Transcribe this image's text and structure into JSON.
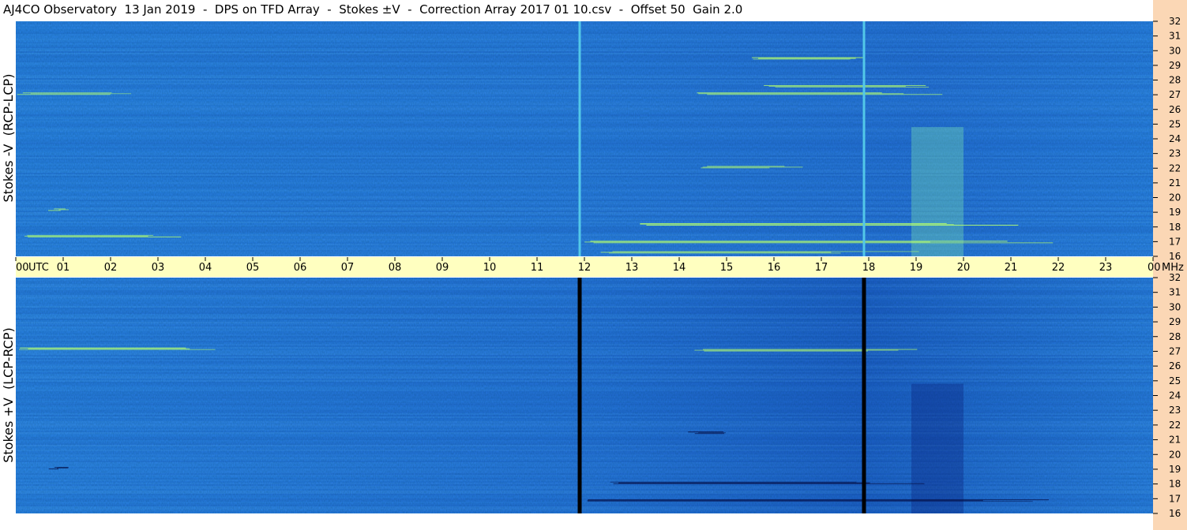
{
  "title": "AJ4CO Observatory  13 Jan 2019  -  DPS on TFD Array  -  Stokes ±V  -  Correction Array 2017 01 10.csv  -  Offset 50  Gain 2.0",
  "colors": {
    "background_blue": "#2a7fe8",
    "time_band": "#ffffc0",
    "mhz_strip": "#fbd7b5",
    "upper_marker_line": "#53c8e8",
    "lower_marker_line": "#000000"
  },
  "chart_data": [
    {
      "type": "heatmap",
      "name": "upper-panel",
      "ylabel": "Stokes -V  (RCP-LCP)",
      "x": {
        "unit": "UTC",
        "range": [
          0,
          24
        ]
      },
      "y": {
        "unit": "MHz",
        "range": [
          16,
          32
        ],
        "ticks": [
          "32",
          "31",
          "30",
          "29",
          "28",
          "27",
          "26",
          "25",
          "24",
          "23",
          "22",
          "21",
          "20",
          "19",
          "18",
          "17",
          "16"
        ]
      },
      "vertical_markers_utc": [
        11.9,
        17.9
      ],
      "features": [
        {
          "utc_start": 12.3,
          "utc_end": 19.5,
          "mhz": 16.3,
          "kind": "bright"
        },
        {
          "utc_start": 12.0,
          "utc_end": 22.5,
          "mhz": 17.0,
          "kind": "bright"
        },
        {
          "utc_start": 13.0,
          "utc_end": 21.0,
          "mhz": 18.2,
          "kind": "bright"
        },
        {
          "utc_start": 14.3,
          "utc_end": 19.3,
          "mhz": 27.1,
          "kind": "bright"
        },
        {
          "utc_start": 15.7,
          "utc_end": 19.8,
          "mhz": 27.6,
          "kind": "bright"
        },
        {
          "utc_start": 15.5,
          "utc_end": 18.6,
          "mhz": 29.5,
          "kind": "bright"
        },
        {
          "utc_start": 14.3,
          "utc_end": 16.5,
          "mhz": 22.1,
          "kind": "bright"
        },
        {
          "utc_start": 0.0,
          "utc_end": 2.5,
          "mhz": 27.1,
          "kind": "bright"
        },
        {
          "utc_start": 0.1,
          "utc_end": 3.6,
          "mhz": 17.4,
          "kind": "bright"
        },
        {
          "utc_start": 0.6,
          "utc_end": 0.9,
          "mhz": 19.2,
          "kind": "bright"
        }
      ]
    },
    {
      "type": "heatmap",
      "name": "lower-panel",
      "ylabel": "Stokes +V  (LCP-RCP)",
      "x": {
        "unit": "UTC",
        "range": [
          0,
          24
        ]
      },
      "y": {
        "unit": "MHz",
        "range": [
          16,
          32
        ],
        "ticks": [
          "32",
          "31",
          "30",
          "29",
          "28",
          "27",
          "26",
          "25",
          "24",
          "23",
          "22",
          "21",
          "20",
          "19",
          "18",
          "17",
          "16"
        ]
      },
      "vertical_markers_utc": [
        11.9,
        17.9
      ],
      "features": [
        {
          "utc_start": 12.0,
          "utc_end": 22.3,
          "mhz": 16.9,
          "kind": "dark"
        },
        {
          "utc_start": 12.5,
          "utc_end": 20.0,
          "mhz": 18.1,
          "kind": "dark"
        },
        {
          "utc_start": 14.3,
          "utc_end": 19.2,
          "mhz": 27.1,
          "kind": "bright"
        },
        {
          "utc_start": 14.1,
          "utc_end": 15.0,
          "mhz": 21.5,
          "kind": "dark"
        },
        {
          "utc_start": 0.0,
          "utc_end": 5.5,
          "mhz": 27.2,
          "kind": "bright"
        },
        {
          "utc_start": 0.6,
          "utc_end": 0.9,
          "mhz": 19.1,
          "kind": "dark"
        }
      ]
    }
  ],
  "time_axis": {
    "utc_label": "UTC",
    "mhz_label": "MHz",
    "hours": [
      "00",
      "01",
      "02",
      "03",
      "04",
      "05",
      "06",
      "07",
      "08",
      "09",
      "10",
      "11",
      "12",
      "13",
      "14",
      "15",
      "16",
      "17",
      "18",
      "19",
      "20",
      "21",
      "22",
      "23",
      "00"
    ]
  }
}
